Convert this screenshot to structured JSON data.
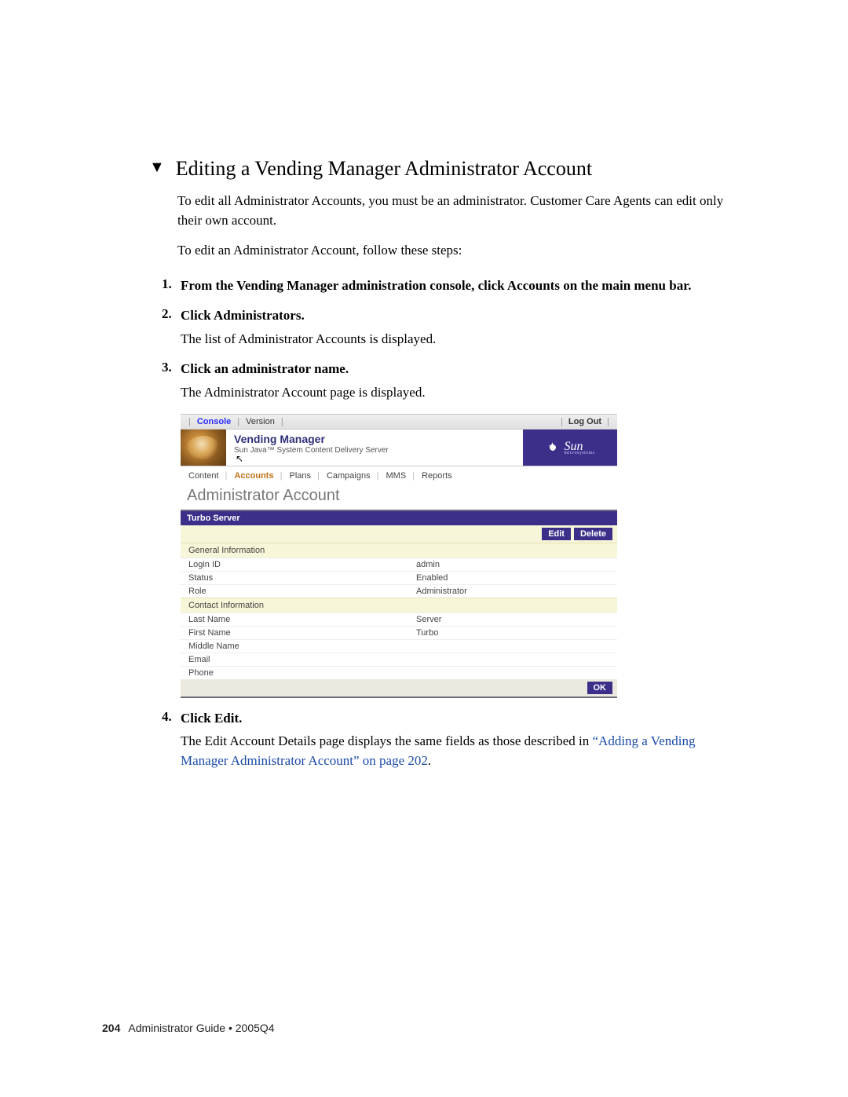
{
  "doc": {
    "section_title": "Editing a Vending Manager Administrator Account",
    "intro_1": "To edit all Administrator Accounts, you must be an administrator. Customer Care Agents can edit only their own account.",
    "intro_2": "To edit an Administrator Account, follow these steps:",
    "steps": [
      {
        "title": "From the Vending Manager administration console, click Accounts on the main menu bar."
      },
      {
        "title": "Click Administrators.",
        "body": "The list of Administrator Accounts is displayed."
      },
      {
        "title": "Click an administrator name.",
        "body": "The Administrator Account page is displayed."
      },
      {
        "title": "Click Edit.",
        "body": "The Edit Account Details page displays the same fields as those described in ",
        "link": "“Adding a Vending Manager Administrator Account” on page 202",
        "tail": "."
      }
    ],
    "footer": {
      "page": "204",
      "text": "Administrator Guide  •  2005Q4"
    }
  },
  "app": {
    "topbar": {
      "console": "Console",
      "version": "Version",
      "logout": "Log Out"
    },
    "header": {
      "title": "Vending Manager",
      "subtitle": "Sun Java™ System Content Delivery Server",
      "brand_name": "Sun",
      "brand_sub": "microsystems"
    },
    "nav": {
      "items": [
        "Content",
        "Accounts",
        "Plans",
        "Campaigns",
        "MMS",
        "Reports"
      ],
      "active_index": 1
    },
    "page_title": "Administrator Account",
    "block": {
      "title": "Turbo Server",
      "buttons": {
        "edit": "Edit",
        "delete": "Delete",
        "ok": "OK"
      },
      "sections": [
        {
          "head": "General Information",
          "rows": [
            {
              "k": "Login ID",
              "v": "admin"
            },
            {
              "k": "Status",
              "v": "Enabled"
            },
            {
              "k": "Role",
              "v": "Administrator"
            }
          ]
        },
        {
          "head": "Contact Information",
          "rows": [
            {
              "k": "Last Name",
              "v": "Server"
            },
            {
              "k": "First Name",
              "v": "Turbo"
            },
            {
              "k": "Middle Name",
              "v": ""
            },
            {
              "k": "Email",
              "v": ""
            },
            {
              "k": "Phone",
              "v": ""
            }
          ]
        }
      ]
    }
  }
}
